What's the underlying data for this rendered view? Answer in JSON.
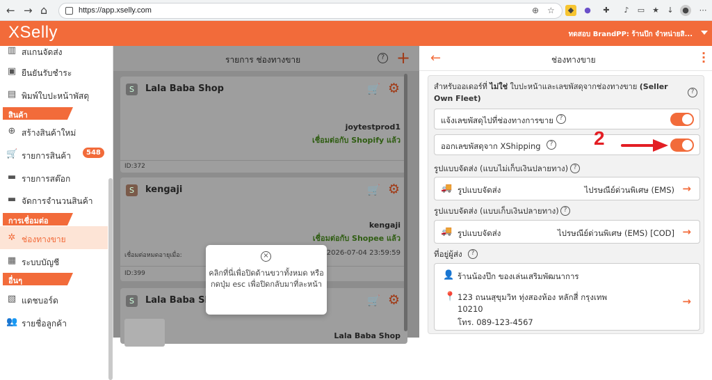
{
  "browser": {
    "url": "https://app.xselly.com",
    "back_icon": "←",
    "forward_icon": "→",
    "refresh_icon": "↻",
    "home_icon": "⌂"
  },
  "app": {
    "logo": "XSelly",
    "store_name": "ทดสอบ BrandPP: ร้านป๊ก จำหน่ายสิ..."
  },
  "sidebar": {
    "items_top": [
      {
        "label": "สแกนจัดส่ง",
        "icon": "barcode-icon"
      },
      {
        "label": "ยืนยันรับชำระ",
        "icon": "money-icon"
      },
      {
        "label": "พิมพ์ใบปะหน้าพัสดุ",
        "icon": "printer-icon"
      }
    ],
    "section_products": "สินค้า",
    "items_products": [
      {
        "label": "สร้างสินค้าใหม่",
        "icon": "plus-circle-icon"
      },
      {
        "label": "รายการสินค้า",
        "icon": "cart-icon",
        "badge": "548"
      },
      {
        "label": "รายการสต๊อก",
        "icon": "box-icon"
      },
      {
        "label": "จัดการจำนวนสินค้า",
        "icon": "box-icon"
      }
    ],
    "section_connect": "การเชื่อมต่อ",
    "items_connect": [
      {
        "label": "ช่องทางขาย",
        "icon": "network-icon"
      },
      {
        "label": "ระบบบัญชี",
        "icon": "document-icon"
      }
    ],
    "section_other": "อื่นๆ",
    "items_other": [
      {
        "label": "แดชบอร์ด",
        "icon": "chart-icon"
      },
      {
        "label": "รายชื่อลูกค้า",
        "icon": "users-icon"
      }
    ]
  },
  "middle": {
    "title": "รายการ ช่องทางขาย",
    "cards": [
      {
        "name": "Lala Baba Shop",
        "account": "joytestprod1",
        "connected": "เชื่อมต่อกับ Shopify แล้ว",
        "id": "ID:372"
      },
      {
        "name": "kengaji",
        "account": "kengaji",
        "connected": "เชื่อมต่อกับ Shopee แล้ว",
        "expire_label": "เชื่อมต่อหมดอายุเมื่อ:",
        "expire_date": "2026-07-04 23:59:59",
        "id": "ID:399"
      },
      {
        "name": "Lala Baba Shop",
        "account": "Lala Baba Shop"
      }
    ],
    "tooltip": "คลิกที่นี่เพื่อปิดด้านขวาทั้งหมด หรือ กดปุ่ม esc เพื่อปิดกลับมาที่ละหน้า"
  },
  "right": {
    "title": "ช่องทางขาย",
    "note_prefix": "สำหรับออเดอร์ที่ ",
    "note_bold": "ไม่ใช่",
    "note_mid": " ใบปะหน้าและเลขพัสดุจากช่องทางขาย ",
    "note_suffix": "(Seller Own Fleet)",
    "toggle1_label": "แจ้งเลขพัสดุไปที่ช่องทางการขาย",
    "toggle2_label": "ออกเลขพัสดุจาก XShipping",
    "ship1_section": "รูปแบบจัดส่ง (แบบไม่เก็บเงินปลายทาง)",
    "ship1_label": "รูปแบบจัดส่ง",
    "ship1_value": "ไปรษณีย์ด่วนพิเศษ (EMS)",
    "ship2_section": "รูปแบบจัดส่ง (แบบเก็บเงินปลายทาง)",
    "ship2_label": "รูปแบบจัดส่ง",
    "ship2_value": "ไปรษณีย์ด่วนพิเศษ (EMS) [COD]",
    "sender_section": "ที่อยู่ผู้ส่ง",
    "sender_name": "ร้านน้องป๊ก ของเล่นเสริมพัฒนาการ",
    "sender_address1": "123 ถนนสุขุมวิท ทุ่งสองห้อง หลักสี่ กรุงเทพ",
    "sender_address2": "10210",
    "sender_phone": "โทร. 089-123-4567"
  },
  "annotation": {
    "number": "2",
    "color": "#e31e24"
  },
  "colors": {
    "accent": "#f26b3a"
  }
}
